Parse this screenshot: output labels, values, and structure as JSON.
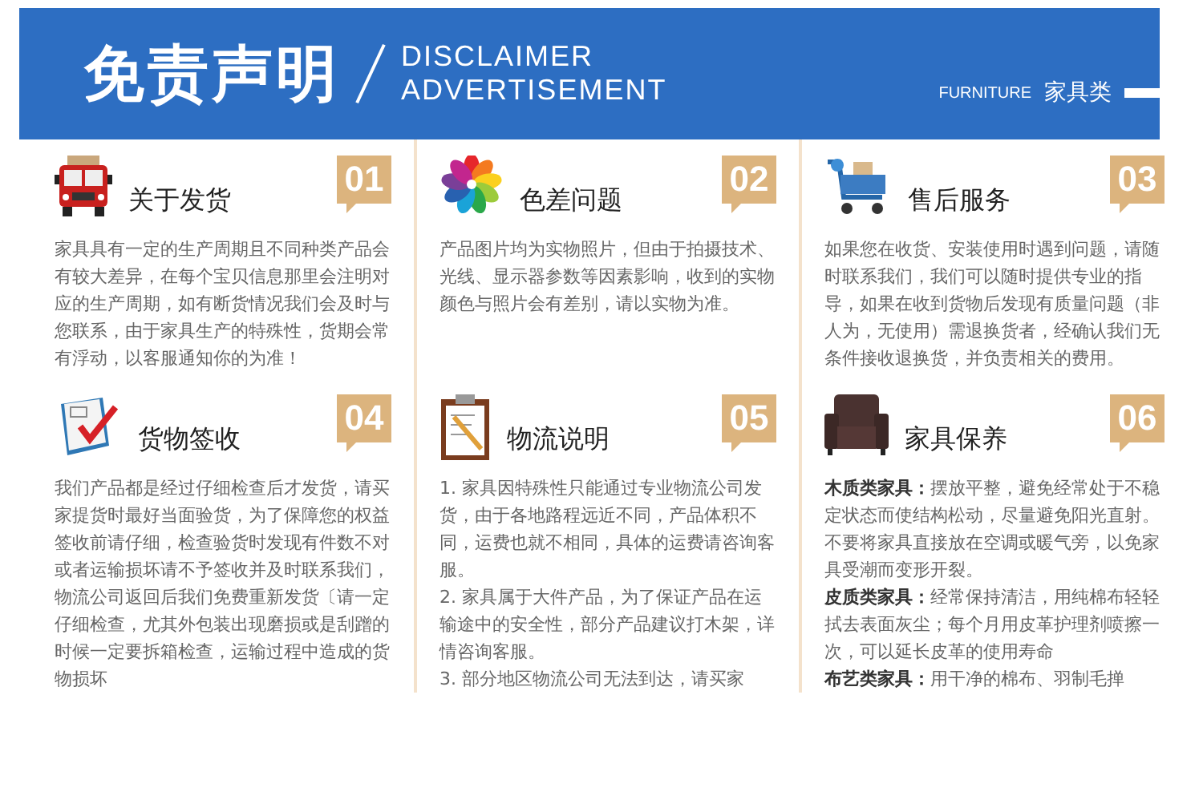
{
  "banner": {
    "title": "免责声明",
    "subtitle": [
      "DISCLAIMER",
      "ADVERTISEMENT"
    ],
    "category_en": "FURNITURE",
    "category": "家具类"
  },
  "sections": [
    {
      "number": "01",
      "heading": "关于发货",
      "paragraphs": [
        "家具具有一定的生产周期且不同种类产品会有较大差异，在每个宝贝信息那里会注明对应的生产周期，如有断货情况我们会及时与您联系，由于家具生产的特殊性，货期会常有浮动，以客服通知你的为准！"
      ]
    },
    {
      "number": "02",
      "heading": "色差问题",
      "paragraphs": [
        "产品图片均为实物照片，但由于拍摄技术、光线、显示器参数等因素影响，收到的实物颜色与照片会有差别，请以实物为准。"
      ]
    },
    {
      "number": "03",
      "heading": "售后服务",
      "paragraphs": [
        "如果您在收货、安装使用时遇到问题，请随时联系我们，我们可以随时提供专业的指导，如果在收到货物后发现有质量问题（非人为，无使用）需退换货者，经确认我们无条件接收退换货，并负责相关的费用。"
      ]
    },
    {
      "number": "04",
      "heading": "货物签收",
      "paragraphs": [
        "我们产品都是经过仔细检查后才发货，请买家提货时最好当面验货，为了保障您的权益签收前请仔细，检查验货时发现有件数不对或者运输损坏请不予签收并及时联系我们，物流公司返回后我们免费重新发货〔请一定仔细检查，尤其外包装出现磨损或是刮蹭的时候一定要拆箱检查，运输过程中造成的货物损坏"
      ]
    },
    {
      "number": "05",
      "heading": "物流说明",
      "paragraphs": [
        "1. 家具因特殊性只能通过专业物流公司发货，由于各地路程远近不同，产品体积不同，运费也就不相同，具体的运费请咨询客服。",
        "2. 家具属于大件产品，为了保证产品在运输途中的安全性，部分产品建议打木架，详情咨询客服。",
        "3. 部分地区物流公司无法到达，请买家"
      ]
    },
    {
      "number": "06",
      "heading": "家具保养",
      "paragraphs": [
        "**木质类家具：**摆放平整，避免经常处于不稳定状态而使结构松动，尽量避免阳光直射。不要将家具直接放在空调或暖气旁，以免家具受潮而变形开裂。",
        "**皮质类家具：**经常保持清洁，用纯棉布轻轻拭去表面灰尘；每个月用皮革护理剂喷擦一次，可以延长皮革的使用寿命",
        "**布艺类家具：**用干净的棉布、羽制毛掸"
      ]
    }
  ]
}
